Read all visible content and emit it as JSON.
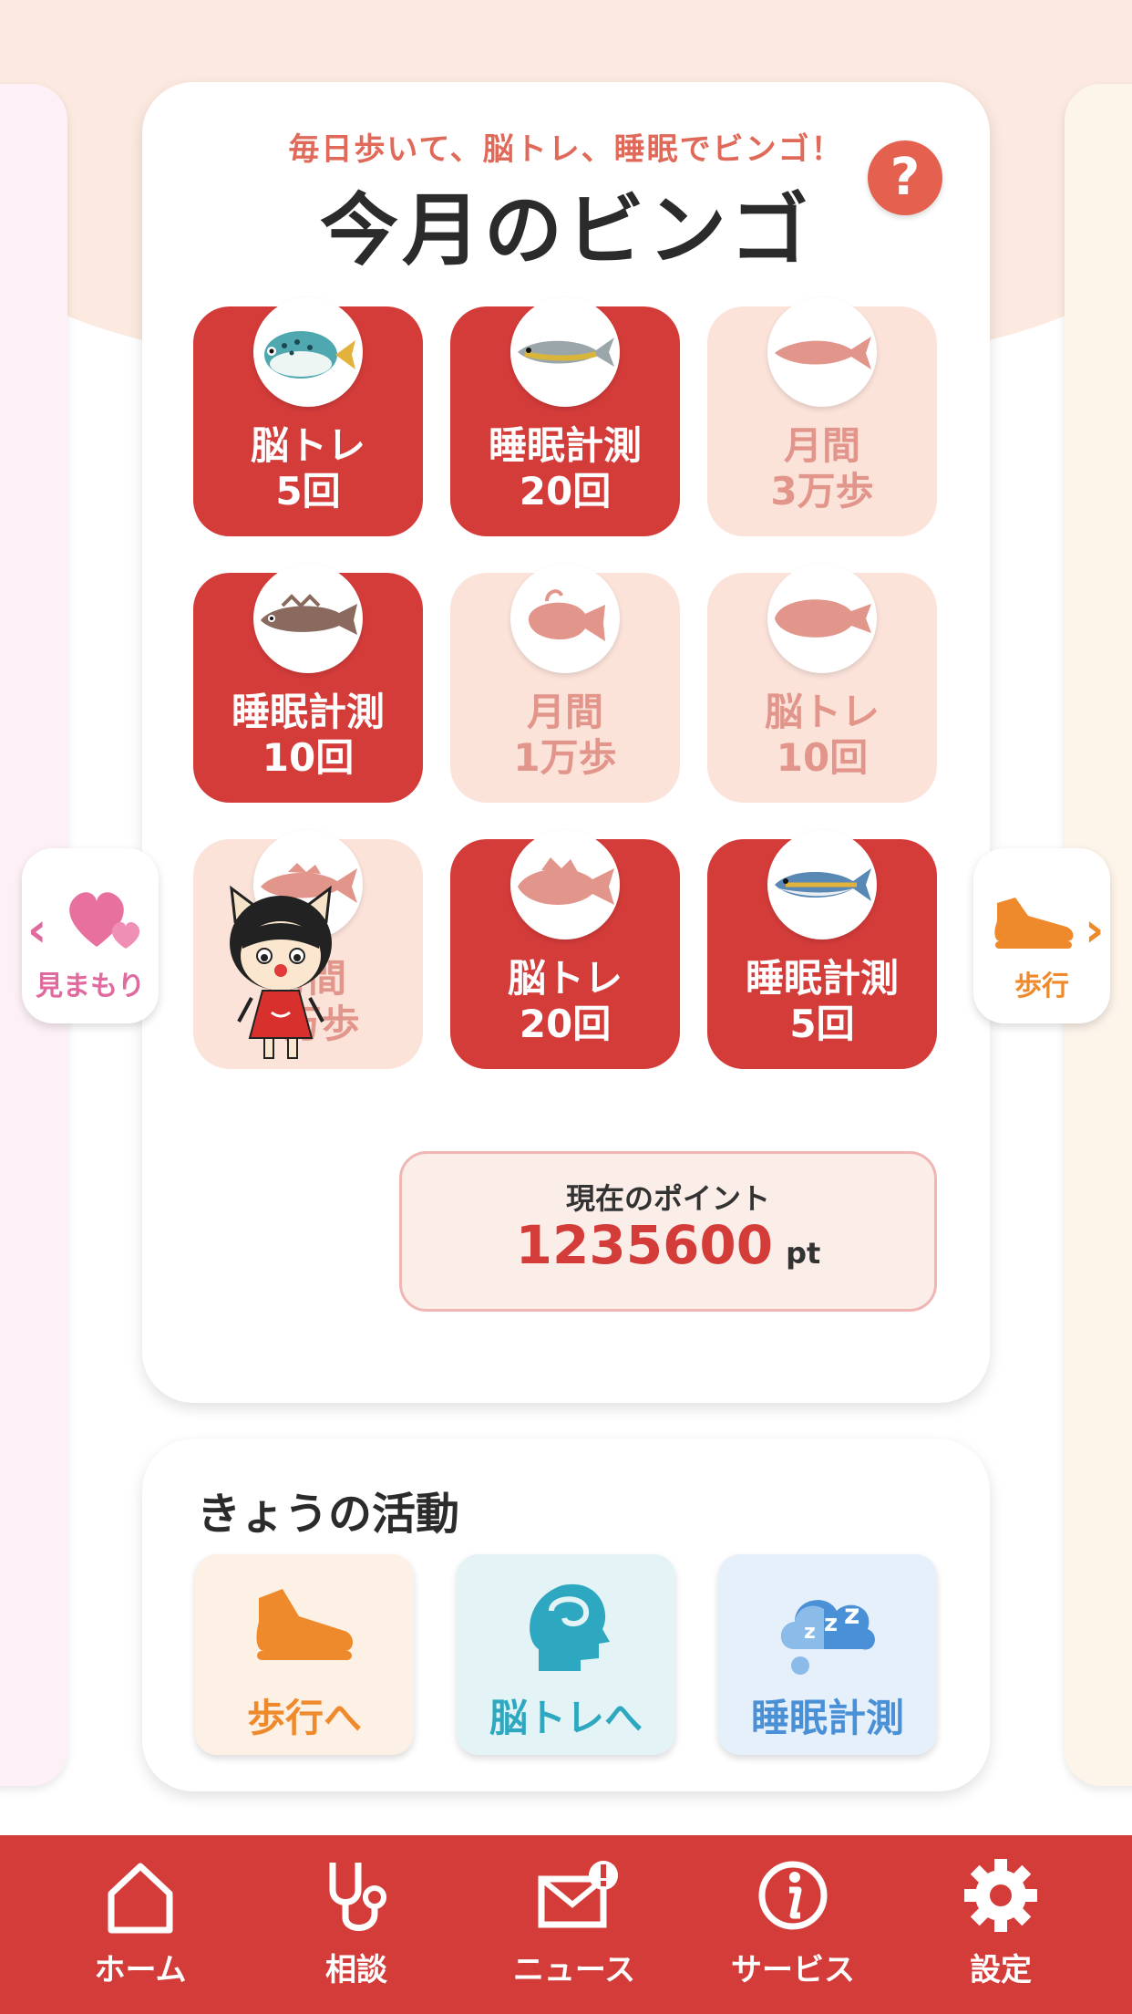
{
  "bingo": {
    "subtitle": "毎日歩いて、脳トレ、睡眠でビンゴ！",
    "title": "今月のビンゴ",
    "help_label": "?",
    "tiles": [
      {
        "line1": "脳トレ",
        "line2": "5回",
        "status": "done",
        "fish": "pufferfish"
      },
      {
        "line1": "睡眠計測",
        "line2": "20回",
        "status": "done",
        "fish": "fish"
      },
      {
        "line1": "月間",
        "line2": "3万歩",
        "status": "pending",
        "fish": "fish"
      },
      {
        "line1": "睡眠計測",
        "line2": "10回",
        "status": "done",
        "fish": "fish"
      },
      {
        "line1": "月間",
        "line2": "1万歩",
        "status": "pending",
        "fish": "anglerfish"
      },
      {
        "line1": "脳トレ",
        "line2": "10回",
        "status": "pending",
        "fish": "flatfish"
      },
      {
        "line1": "月間",
        "line2": "5万歩",
        "status": "pending",
        "fish": "fish"
      },
      {
        "line1": "脳トレ",
        "line2": "20回",
        "status": "done",
        "fish": "fish"
      },
      {
        "line1": "睡眠計測",
        "line2": "5回",
        "status": "done",
        "fish": "fish"
      }
    ]
  },
  "side_nav": {
    "left": {
      "label": "見まもり",
      "arrow": "‹",
      "icon": "hearts-icon"
    },
    "right": {
      "label": "歩行",
      "arrow": "›",
      "icon": "sneaker-icon"
    }
  },
  "points": {
    "label": "現在のポイント",
    "value": "1235600",
    "unit": "pt"
  },
  "activity": {
    "title": "きょうの活動",
    "buttons": [
      {
        "label": "歩行へ",
        "icon": "sneaker-icon",
        "color": "#ef8a2c",
        "bg": "#fdf0e4"
      },
      {
        "label": "脳トレへ",
        "icon": "brain-head-icon",
        "color": "#2ea8c0",
        "bg": "#e4f4f6"
      },
      {
        "label": "睡眠計測",
        "icon": "sleep-cloud-icon",
        "color": "#4a90d6",
        "bg": "#e6f0fa"
      }
    ]
  },
  "bottom_nav": [
    {
      "label": "ホーム",
      "icon": "home-icon"
    },
    {
      "label": "相談",
      "icon": "stethoscope-icon"
    },
    {
      "label": "ニュース",
      "icon": "mail-alert-icon"
    },
    {
      "label": "サービス",
      "icon": "info-icon"
    },
    {
      "label": "設定",
      "icon": "gear-icon"
    }
  ],
  "colors": {
    "accent_red": "#d43c3a",
    "pending_tile": "#fbe3da",
    "pending_text": "#e2958a"
  }
}
